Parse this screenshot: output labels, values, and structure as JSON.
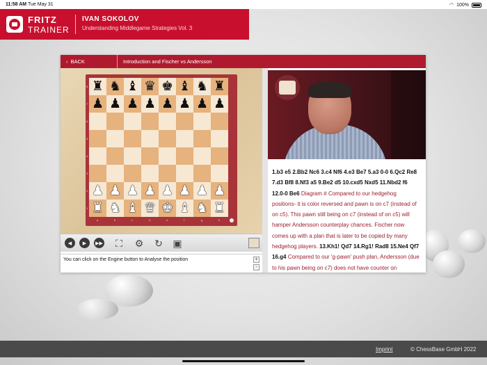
{
  "status_bar": {
    "time": "11:58 AM",
    "date": "Tue May 31",
    "battery": "100%"
  },
  "header": {
    "brand_line1": "FRITZ",
    "brand_line2": "TRAINER",
    "author": "IVAN SOKOLOV",
    "course": "Understanding Middlegame Strategies Vol. 3"
  },
  "nav": {
    "back_label": "BACK",
    "chapter_title": "Introduction and Fischer vs Andersson"
  },
  "board": {
    "rows": [
      [
        "r",
        "n",
        "b",
        "q",
        "k",
        "b",
        "n",
        "r"
      ],
      [
        "p",
        "p",
        "p",
        "p",
        "p",
        "p",
        "p",
        "p"
      ],
      [
        "",
        "",
        "",
        "",
        "",
        "",
        "",
        ""
      ],
      [
        "",
        "",
        "",
        "",
        "",
        "",
        "",
        ""
      ],
      [
        "",
        "",
        "",
        "",
        "",
        "",
        "",
        ""
      ],
      [
        "",
        "",
        "",
        "",
        "",
        "",
        "",
        ""
      ],
      [
        "P",
        "P",
        "P",
        "P",
        "P",
        "P",
        "P",
        "P"
      ],
      [
        "R",
        "N",
        "B",
        "Q",
        "K",
        "B",
        "N",
        "R"
      ]
    ],
    "rank_labels": [
      "8",
      "7",
      "6",
      "5",
      "4",
      "3",
      "2",
      "1"
    ],
    "file_labels": [
      "a",
      "b",
      "c",
      "d",
      "e",
      "f",
      "g",
      "h"
    ]
  },
  "toolbar": {
    "icons": [
      "prev-arrow-icon",
      "next-arrow-icon",
      "fast-forward-icon",
      "fullscreen-icon",
      "engine-icon",
      "rotate-icon",
      "save-icon",
      "mini-board-icon"
    ]
  },
  "engine_hint": "You can click on the Engine button to Analyse the position",
  "notation": [
    {
      "t": "mv",
      "s": "1.b3 e5 2.Bb2 Nc6 3.c4 Nf6 4.e3 Be7 5.a3 0-0 6.Qc2 Re8 7.d3 Bf8 8.Nf3 a5 9.Be2 d5 10.cxd5 Nxd5 11.Nbd2 f6 12.0-0 Be6 "
    },
    {
      "t": "cm",
      "s": "Diagram # Compared to our hedgehog positions- it is color reversed and pawn is on c7 (instead of on c5). This pawn still being on c7 (instead of on c5) will hamper Andersson counterplay chances. Fischer now comes up with a plan that is later to be copied by many hedgehog players. "
    },
    {
      "t": "mv",
      "s": "13.Kh1! Qd7 14.Rg1! Rad8 15.Ne4 Qf7 16.g4 "
    },
    {
      "t": "cm",
      "s": "Compared to our 'g-pawn' push plan, Andersson (due to his pawn being on c7) does not have counter on"
    }
  ],
  "footer": {
    "imprint": "Imprint",
    "copyright": "© ChessBase GmbH 2022"
  },
  "colors": {
    "brand_red": "#c8102e",
    "nav_red": "#b01a2e",
    "comment_red": "#9a1f2d",
    "board_light": "#f6e8d3",
    "board_dark": "#e6b27d"
  }
}
